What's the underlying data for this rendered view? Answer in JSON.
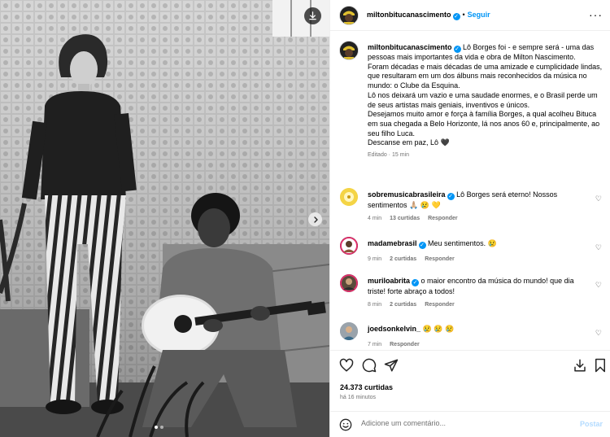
{
  "post": {
    "username": "miltonbitucanascimento",
    "follow_label": "Seguir",
    "separator": "•",
    "more_label": "···",
    "caption_lines": [
      "Lô Borges foi - e sempre será - uma das pessoas mais importantes da vida e obra de Milton Nascimento.",
      "Foram décadas e mais décadas de uma amizade e cumplicidade lindas, que resultaram em um dos álbuns mais reconhecidos da música no mundo: o Clube da Esquina.",
      "Lô nos deixará um vazio e uma saudade enormes, e o Brasil perde um de seus artistas mais geniais, inventivos e únicos.",
      "Desejamos muito amor e força à família Borges, a qual acolheu Bituca em sua chegada a Belo Horizonte, lá nos anos 60 e, principalmente, ao seu filho Luca.",
      "Descanse em paz, Lô 🖤"
    ],
    "caption_meta": "Editado · 15 min",
    "likes": "24.373 curtidas",
    "time": "há 16 minutos"
  },
  "comments": [
    {
      "username": "sobremusicabrasileira",
      "verified": true,
      "text": "Lô Borges será eterno! Nossos sentimentos 🙏🏼 😢 💛",
      "time": "4 min",
      "likes": "13 curtidas",
      "reply": "Responder"
    },
    {
      "username": "madamebrasil",
      "verified": true,
      "text": "Meu sentimentos. 😢",
      "time": "9 min",
      "likes": "2 curtidas",
      "reply": "Responder"
    },
    {
      "username": "muriloabrita",
      "verified": true,
      "text": "o maior encontro da música do mundo! que dia triste! forte abraço a todos!",
      "time": "8 min",
      "likes": "2 curtidas",
      "reply": "Responder"
    },
    {
      "username": "joedsonkelvin_",
      "verified": false,
      "text": "😢 😢 😢",
      "time": "7 min",
      "likes": "",
      "reply": "Responder"
    }
  ],
  "composer": {
    "placeholder": "Adicione um comentário...",
    "post_label": "Postar"
  },
  "icons": {
    "verified": "✓",
    "heart_small": "♡"
  },
  "colors": {
    "accent": "#0095f6",
    "muted": "#737373",
    "post_disabled": "#b3dbff"
  }
}
